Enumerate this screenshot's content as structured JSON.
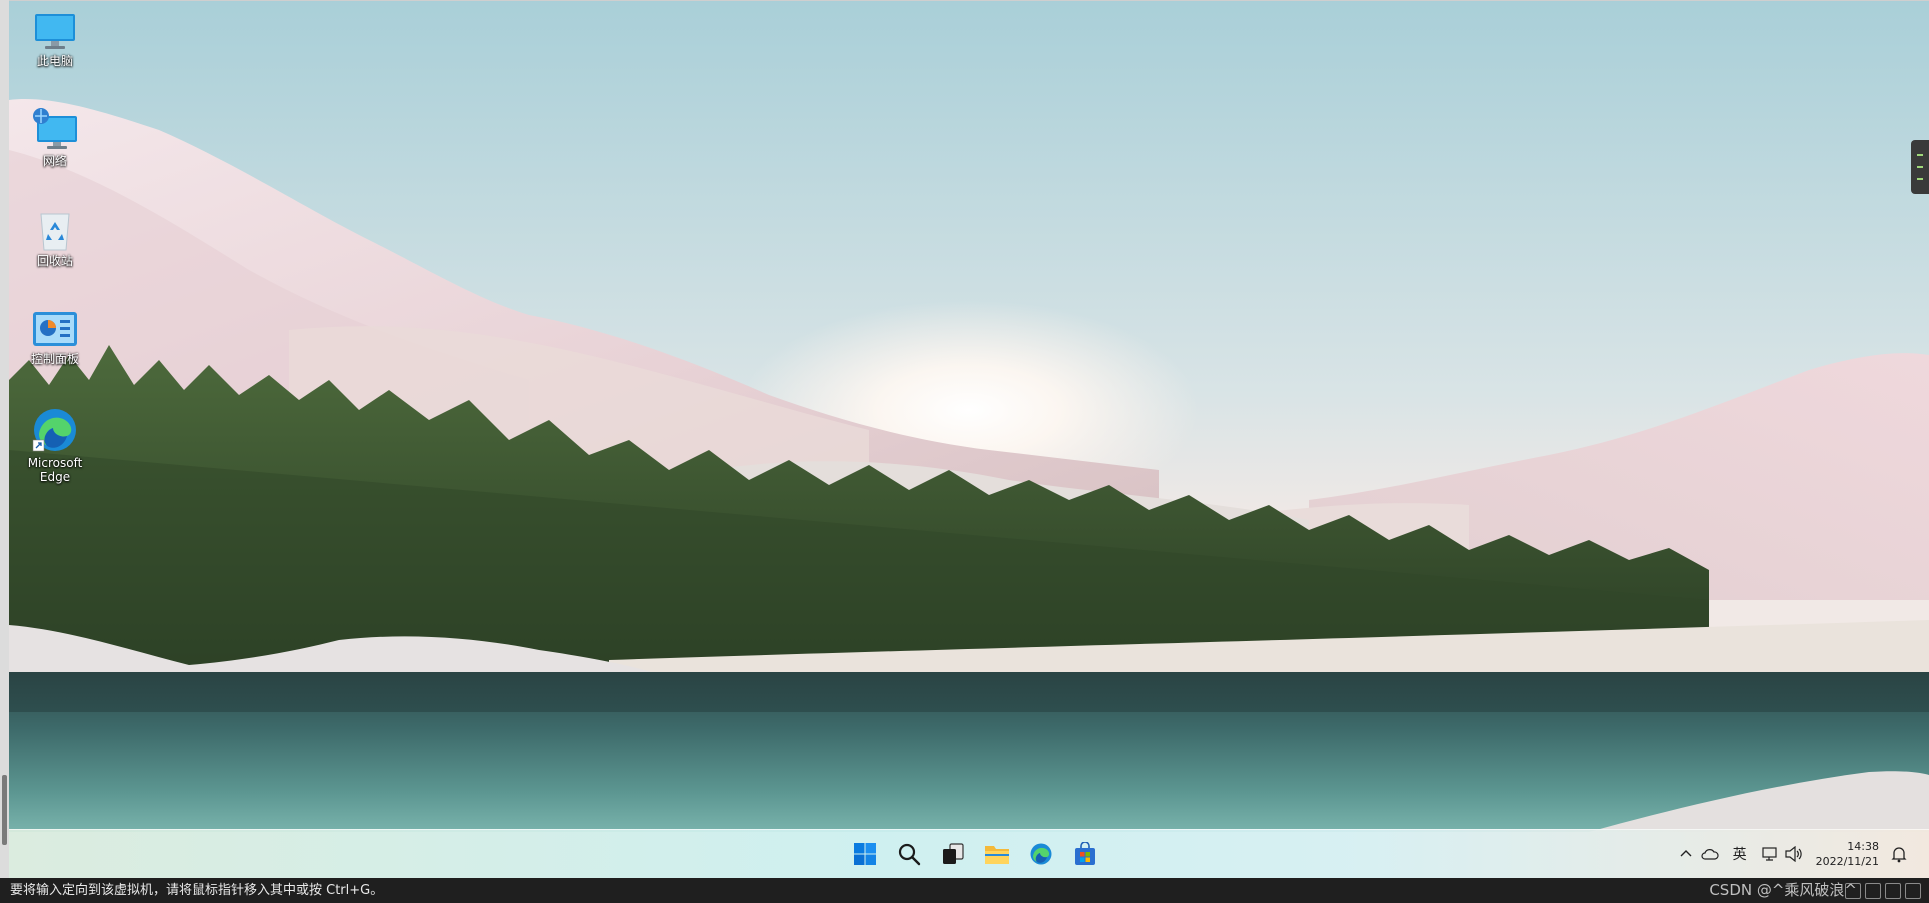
{
  "desktop": {
    "icons": [
      {
        "label": "此电脑"
      },
      {
        "label": "网络"
      },
      {
        "label": "回收站"
      },
      {
        "label": "控制面板"
      },
      {
        "label": "Microsoft Edge"
      }
    ]
  },
  "taskbar": {
    "apps": [
      {
        "icon": "windows-start-icon"
      },
      {
        "icon": "search-icon"
      },
      {
        "icon": "task-view-icon"
      },
      {
        "icon": "file-explorer-icon"
      },
      {
        "icon": "edge-icon"
      },
      {
        "icon": "microsoft-store-icon"
      }
    ],
    "tray": {
      "ime": "英",
      "time": "14:38",
      "date": "2022/11/21"
    }
  },
  "statusbar": {
    "message": "要将输入定向到该虚拟机，请将鼠标指针移入其中或按 Ctrl+G。",
    "watermark": "CSDN @^乘风破浪^"
  },
  "colors": {
    "accent": "#0067c0",
    "taskbar": "#cdeff0",
    "statusbar": "#1f1f1f"
  }
}
